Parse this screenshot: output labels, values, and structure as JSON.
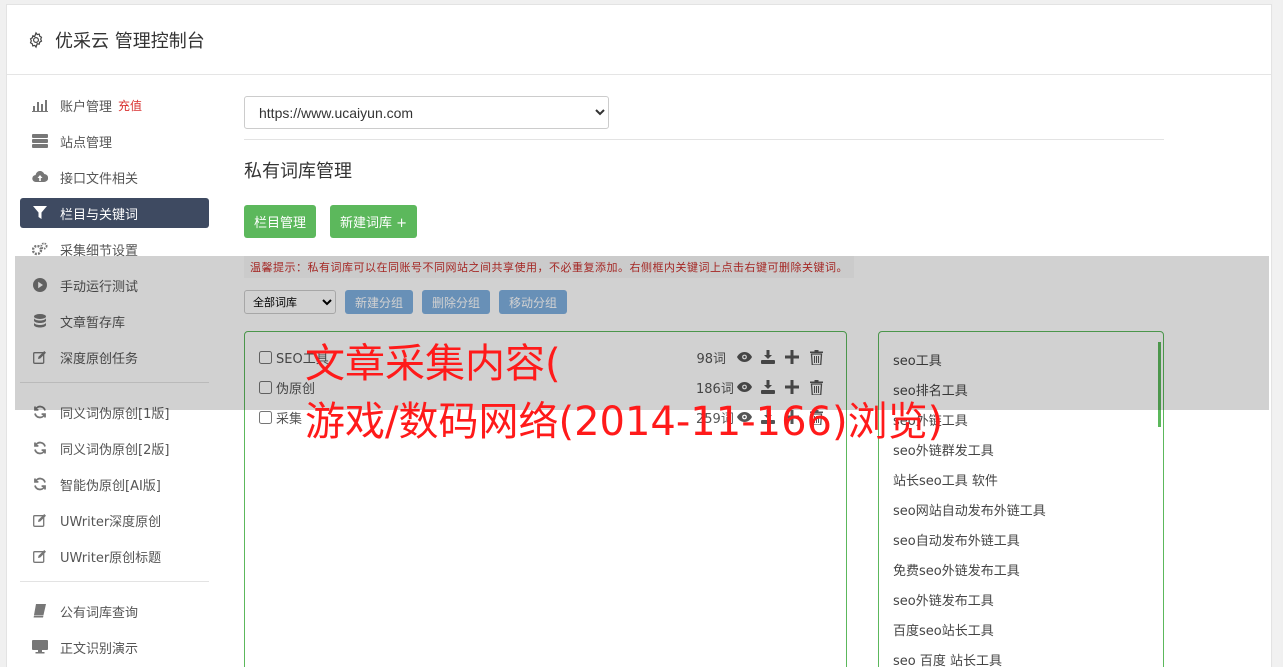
{
  "header": {
    "title": "优采云 管理控制台"
  },
  "sidebar": {
    "recharge_label": "充值",
    "group1": [
      {
        "label": "账户管理",
        "icon": "bar-chart-icon"
      },
      {
        "label": "站点管理",
        "icon": "server-icon"
      },
      {
        "label": "接口文件相关",
        "icon": "cloud-upload-icon"
      },
      {
        "label": "栏目与关键词",
        "icon": "filter-icon",
        "active": true
      },
      {
        "label": "采集细节设置",
        "icon": "gears-icon"
      },
      {
        "label": "手动运行测试",
        "icon": "play-icon"
      },
      {
        "label": "文章暂存库",
        "icon": "database-icon"
      },
      {
        "label": "深度原创任务",
        "icon": "edit-icon"
      }
    ],
    "group2": [
      {
        "label": "同义词伪原创[1版]",
        "icon": "refresh-icon"
      },
      {
        "label": "同义词伪原创[2版]",
        "icon": "refresh-icon"
      },
      {
        "label": "智能伪原创[AI版]",
        "icon": "refresh-icon"
      },
      {
        "label": "UWriter深度原创",
        "icon": "edit-icon"
      },
      {
        "label": "UWriter原创标题",
        "icon": "edit-icon"
      }
    ],
    "group3": [
      {
        "label": "公有词库查询",
        "icon": "book-icon"
      },
      {
        "label": "正文识别演示",
        "icon": "monitor-icon"
      }
    ]
  },
  "main": {
    "site_select_value": "https://www.ucaiyun.com",
    "section_title": "私有词库管理",
    "btn_column_manage": "栏目管理",
    "btn_new_library": "新建词库 +",
    "tip": "温馨提示：私有词库可以在同账号不同网站之间共享使用，不必重复添加。右侧框内关键词上点击右键可删除关键词。",
    "filter_select_value": "全部词库",
    "btn_new_group": "新建分组",
    "btn_delete_group": "删除分组",
    "btn_move_group": "移动分组",
    "libraries": [
      {
        "name": "SEO工具",
        "count": "98词"
      },
      {
        "name": "伪原创",
        "count": "186词"
      },
      {
        "name": "采集",
        "count": "259词"
      }
    ],
    "keywords": [
      "seo工具",
      "seo排名工具",
      "seo外链工具",
      "seo外链群发工具",
      "站长seo工具 软件",
      "seo网站自动发布外链工具",
      "seo自动发布外链工具",
      "免费seo外链发布工具",
      "seo外链发布工具",
      "百度seo站长工具",
      "seo 百度 站长工具"
    ]
  },
  "overlay": {
    "line1": "文章采集内容(",
    "line2": "游戏/数码网络(2014-11-166)浏览)"
  }
}
